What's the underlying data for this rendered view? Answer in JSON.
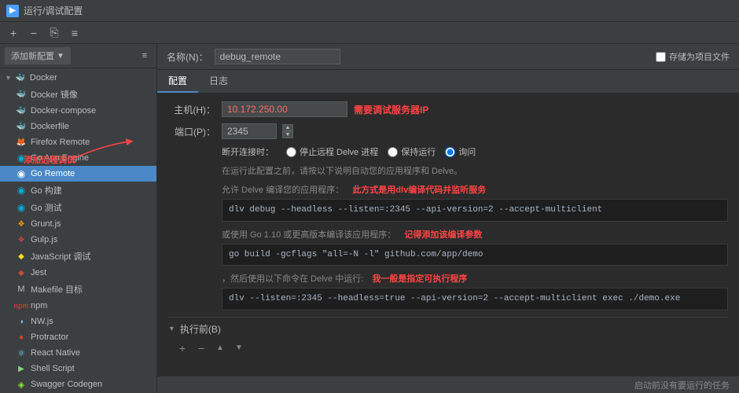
{
  "window": {
    "title": "运行/调试配置",
    "icon": "▶"
  },
  "toolbar": {
    "add_label": "+",
    "remove_label": "−",
    "copy_label": "⎘",
    "sort_label": "↕"
  },
  "sidebar": {
    "add_config_btn": "添加新配置",
    "groups": [
      {
        "name": "Docker",
        "items": [
          {
            "label": "Docker 镜像",
            "icon": "🐳",
            "iconClass": "icon-docker"
          },
          {
            "label": "Docker-compose",
            "icon": "🐳",
            "iconClass": "icon-docker"
          },
          {
            "label": "Dockerfile",
            "icon": "🐳",
            "iconClass": "icon-docker"
          }
        ]
      }
    ],
    "items": [
      {
        "label": "Firefox Remote",
        "icon": "🦊",
        "iconClass": "icon-firefox"
      },
      {
        "label": "Go App Engine",
        "icon": "◉",
        "iconClass": "icon-go"
      },
      {
        "label": "Go Remote",
        "icon": "◉",
        "iconClass": "icon-go",
        "active": true
      },
      {
        "label": "Go 构建",
        "icon": "◉",
        "iconClass": "icon-go"
      },
      {
        "label": "Go 测试",
        "icon": "◉",
        "iconClass": "icon-go"
      },
      {
        "label": "Grunt.js",
        "icon": "❖",
        "iconClass": "icon-grunt"
      },
      {
        "label": "Gulp.js",
        "icon": "❖",
        "iconClass": "icon-js"
      },
      {
        "label": "JavaScript 调试",
        "icon": "◆",
        "iconClass": "icon-js"
      },
      {
        "label": "Jest",
        "icon": "◆",
        "iconClass": "icon-js"
      },
      {
        "label": "Makefile 目标",
        "icon": "▣",
        "iconClass": "icon-makefile"
      },
      {
        "label": "npm",
        "icon": "◼",
        "iconClass": "icon-npm"
      },
      {
        "label": "NW.js",
        "icon": "◑",
        "iconClass": "icon-nw"
      },
      {
        "label": "Protractor",
        "icon": "◉",
        "iconClass": "icon-protractor"
      },
      {
        "label": "React Native",
        "icon": "⚛",
        "iconClass": "icon-react"
      },
      {
        "label": "Shell Script",
        "icon": "▶",
        "iconClass": "icon-shell"
      },
      {
        "label": "Swagger Codegen",
        "icon": "◈",
        "iconClass": "icon-swagger"
      }
    ]
  },
  "config": {
    "name_label": "名称(N)：",
    "name_value": "debug_remote",
    "save_label": "存储为项目文件",
    "tabs": [
      "配置",
      "日志"
    ],
    "active_tab": "配置",
    "host_label": "主机(H)：",
    "host_value": "10.172.250.00",
    "host_hint": "需要调试服务器IP",
    "port_label": "端口(P)：",
    "port_value": "2345",
    "disconnect_label": "断开连接时：",
    "option_stop": "停止远程 Delve 进程",
    "option_keep": "保持运行",
    "option_ask": "询问",
    "info_text": "在运行此配置之前，请按以下说明自动您的应用程序和 Delve。",
    "allow_label": "允许 Delve 编译您的应用程序：",
    "allow_hint": "此方式是用dlv编译代码并监听服务",
    "code1": "dlv debug --headless --listen=:2345 --api-version=2 --accept-multiclient",
    "or_label": "或使用 Go 1.10 或更高版本编译该应用程序：",
    "or_hint": "记得添加该编译参数",
    "code2": "go build -gcflags \"all=-N -l\" github.com/app/demo",
    "then_label": "，然后使用以下命令在 Delve 中运行:",
    "exec_hint": "我一般是指定可执行程序",
    "code3": "dlv --listen=:2345 --headless=true --api-version=2 --accept-multiclient exec ./demo.exe",
    "exec_section": {
      "title": "执行前(B)",
      "toolbar_add": "+",
      "toolbar_remove": "−",
      "toolbar_up": "▲",
      "toolbar_down": "▼",
      "empty_text": "启动前没有要运行的任务"
    }
  },
  "annotations": {
    "add_remote": "添加远程调试",
    "arrow_host": "需要调试服务器IP",
    "arrow_compile": "此方式是用dlv编译代码并监听服务",
    "arrow_build": "记得添加该编译参数",
    "arrow_exec": "我一般是指定可执行程序"
  }
}
